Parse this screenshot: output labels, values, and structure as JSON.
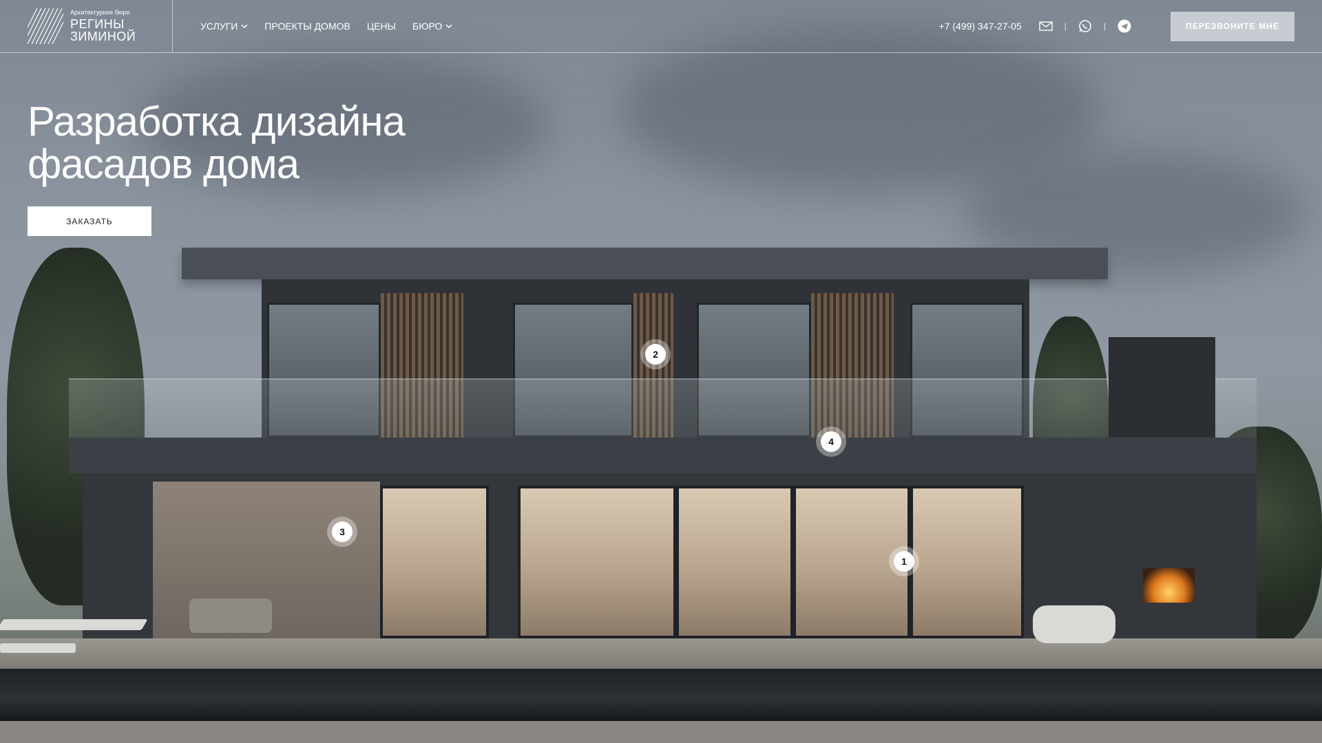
{
  "brand": {
    "tagline": "Архитектурное бюро",
    "name_line1": "РЕГИНЫ",
    "name_line2": "ЗИМИНОЙ"
  },
  "nav": {
    "items": [
      {
        "label": "УСЛУГИ",
        "dropdown": true
      },
      {
        "label": "ПРОЕКТЫ ДОМОВ",
        "dropdown": false
      },
      {
        "label": "ЦЕНЫ",
        "dropdown": false
      },
      {
        "label": "БЮРО",
        "dropdown": true
      }
    ]
  },
  "contacts": {
    "phone": "+7 (499) 347-27-05",
    "icons": [
      "mail-icon",
      "whatsapp-icon",
      "telegram-icon"
    ],
    "separator": "|",
    "callback_label": "ПЕРЕЗВОНИТЕ МНЕ"
  },
  "hero": {
    "title_line1": "Разработка дизайна",
    "title_line2": "фасадов дома",
    "cta_label": "ЗАКАЗАТЬ"
  },
  "hotspots": [
    "1",
    "2",
    "3",
    "4"
  ],
  "colors": {
    "callback_bg": "#c7ccd3",
    "cta_bg": "#ffffff",
    "text": "#ffffff"
  }
}
